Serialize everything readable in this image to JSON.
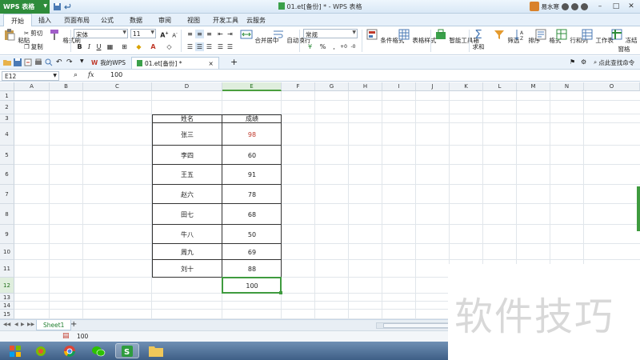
{
  "app": {
    "menu_label": "WPS 表格",
    "window_title": "01.et[备份] * - WPS 表格",
    "user_name": "易水寒"
  },
  "ribbon_tabs": [
    "开始",
    "插入",
    "页面布局",
    "公式",
    "数据",
    "审阅",
    "视图",
    "开发工具",
    "云服务"
  ],
  "ribbon": {
    "paste": "粘贴",
    "cut": "剪切",
    "copy": "复制",
    "format_painter": "格式刷",
    "font_name": "宋体",
    "font_size": "11",
    "merge_center": "合并居中",
    "auto_wrap": "自动换行",
    "number_format": "常规",
    "conditional_format": "条件格式",
    "table_style": "表格样式",
    "smart_toolbox": "智能工具箱",
    "sum": "求和",
    "filter": "筛选",
    "sort": "排序",
    "format": "格式",
    "row_col": "行和列",
    "worksheet": "工作表",
    "freeze": "冻结窗格",
    "percent": "%",
    "thousands": ","
  },
  "doc_tabs": {
    "home": "我的WPS",
    "file": "01.et[备份] *",
    "find_cmd": "点此查找命令"
  },
  "formula_bar": {
    "cell_ref": "E12",
    "fx": "fx",
    "value": "100"
  },
  "columns": [
    "A",
    "B",
    "C",
    "D",
    "E",
    "F",
    "G",
    "H",
    "I",
    "J",
    "K",
    "L",
    "M",
    "N",
    "O"
  ],
  "rows": [
    "1",
    "2",
    "3",
    "4",
    "5",
    "6",
    "7",
    "8",
    "9",
    "10",
    "11",
    "12",
    "13",
    "14",
    "15"
  ],
  "table": {
    "header_name": "姓名",
    "header_score": "成绩",
    "rows": [
      {
        "name": "张三",
        "score": "98"
      },
      {
        "name": "李四",
        "score": "60"
      },
      {
        "name": "王五",
        "score": "91"
      },
      {
        "name": "赵六",
        "score": "78"
      },
      {
        "name": "田七",
        "score": "68"
      },
      {
        "name": "牛八",
        "score": "50"
      },
      {
        "name": "周九",
        "score": "69"
      },
      {
        "name": "刘十",
        "score": "88"
      }
    ],
    "selected_value": "100"
  },
  "sheet": {
    "tab_name": "Sheet1",
    "add": "+"
  },
  "status": {
    "value": "100"
  },
  "watermark": "软件技巧",
  "colors": {
    "accent_green": "#2e8c3b",
    "selection_green": "#3f9b3f",
    "score_red": "#c0392b"
  }
}
